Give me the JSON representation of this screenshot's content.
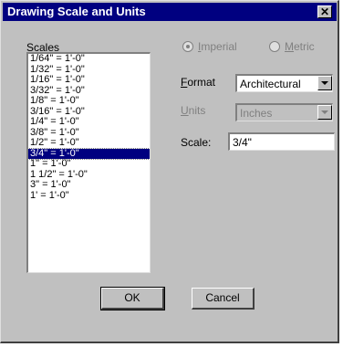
{
  "window": {
    "title": "Drawing Scale and Units",
    "close_glyph": "✕"
  },
  "scales": {
    "label": "Scales",
    "items": [
      "1/64\" = 1'-0\"",
      "1/32\" = 1'-0\"",
      "1/16\" = 1'-0\"",
      "3/32\" = 1'-0\"",
      "1/8\" = 1'-0\"",
      "3/16\" = 1'-0\"",
      "1/4\" = 1'-0\"",
      "3/8\" = 1'-0\"",
      "1/2\" = 1'-0\"",
      "3/4\" = 1'-0\"",
      "1\" = 1'-0\"",
      "1 1/2\" = 1'-0\"",
      "3\" = 1'-0\"",
      "1' = 1'-0\""
    ],
    "selected_index": 9
  },
  "units_system": {
    "imperial_label": "Imperial",
    "metric_label": "Metric",
    "selected": "imperial",
    "enabled": false
  },
  "format": {
    "label": "Format",
    "value": "Architectural"
  },
  "units": {
    "label": "Units",
    "value": "Inches",
    "enabled": false
  },
  "scale": {
    "label": "Scale:",
    "value": "3/4\""
  },
  "buttons": {
    "ok": "OK",
    "cancel": "Cancel"
  }
}
